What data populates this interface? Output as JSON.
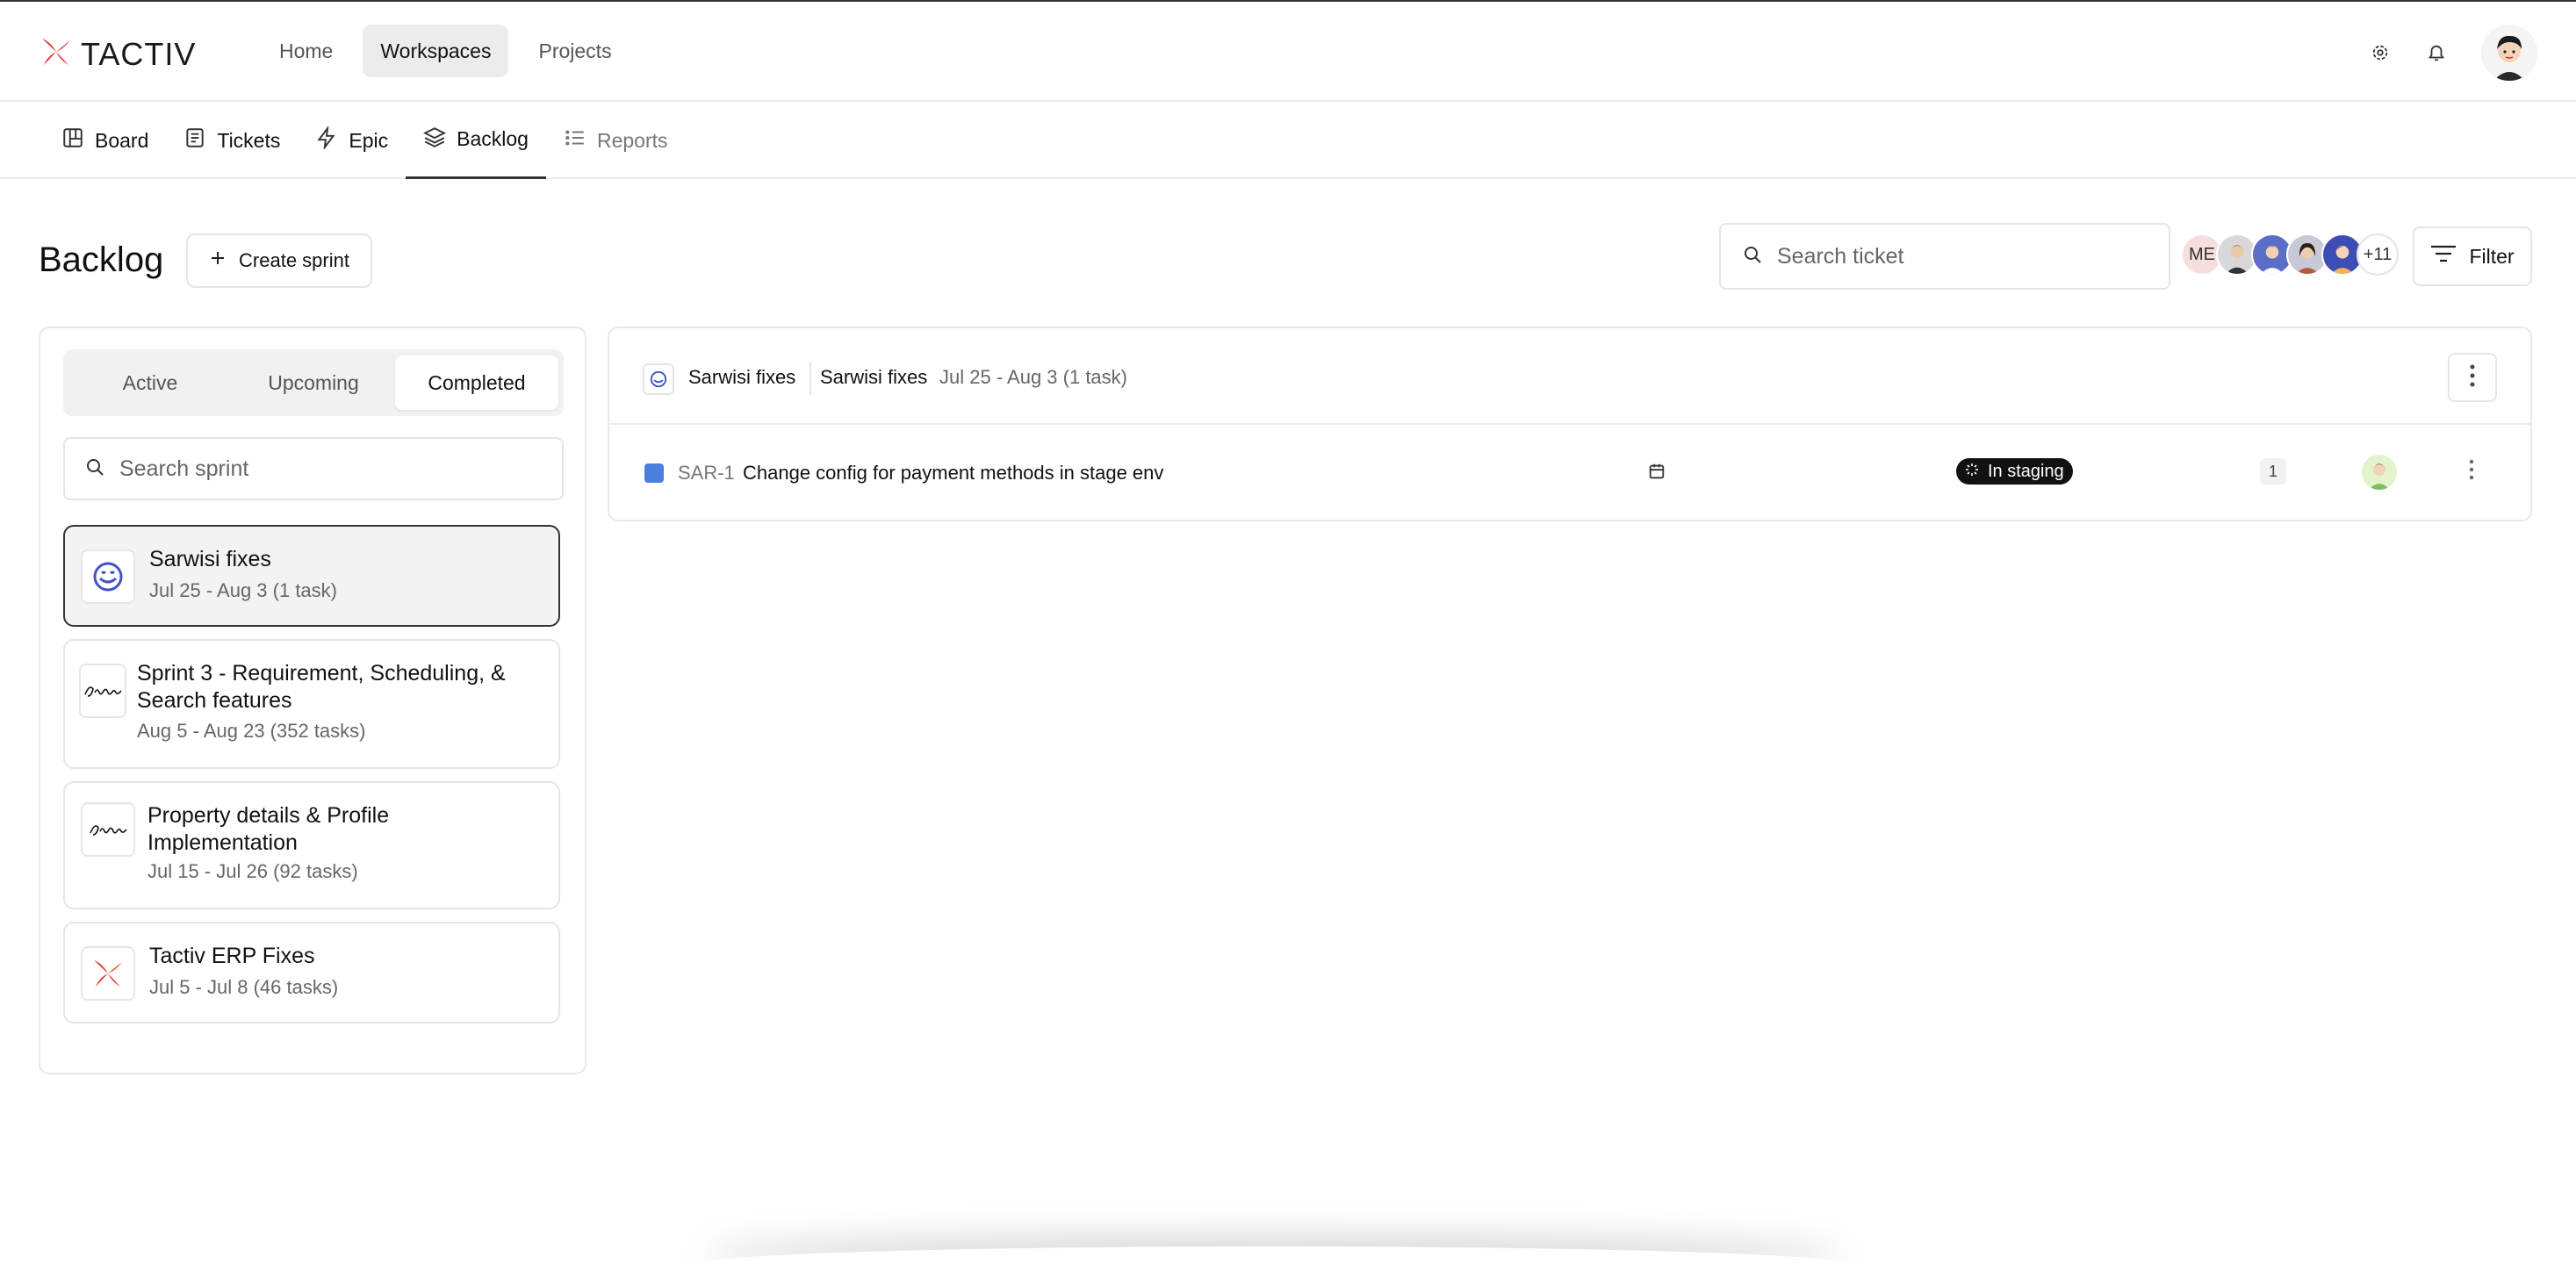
{
  "app": {
    "logo_text": "TACTIV",
    "brand_color": "#e0362c"
  },
  "topnav": [
    {
      "label": "Home",
      "active": false
    },
    {
      "label": "Workspaces",
      "active": true
    },
    {
      "label": "Projects",
      "active": false
    }
  ],
  "top_icons": [
    "gear-icon",
    "bell-icon",
    "user-avatar"
  ],
  "subnav": [
    {
      "label": "Board",
      "icon": "board-icon"
    },
    {
      "label": "Tickets",
      "icon": "tickets-icon"
    },
    {
      "label": "Epic",
      "icon": "lightning-icon"
    },
    {
      "label": "Backlog",
      "icon": "layers-icon",
      "active": true
    },
    {
      "label": "Reports",
      "icon": "list-icon",
      "muted": true
    }
  ],
  "page": {
    "title": "Backlog",
    "create_sprint_label": "Create sprint",
    "search_ticket_placeholder": "Search ticket",
    "members": {
      "me_initials": "ME",
      "more_count": "+11"
    },
    "filter_label": "Filter"
  },
  "sprint_panel": {
    "segments": [
      {
        "label": "Active",
        "active": false
      },
      {
        "label": "Upcoming",
        "active": false
      },
      {
        "label": "Completed",
        "active": true
      }
    ],
    "search_placeholder": "Search sprint",
    "sprints": [
      {
        "name": "Sarwisi fixes",
        "meta": "Jul 25 - Aug 3 (1 task)",
        "icon": "smile-logo-icon",
        "selected": true
      },
      {
        "name": "Sprint 3 - Requirement, Scheduling, & Search features",
        "meta": "Aug 5 - Aug 23 (352 tasks)",
        "icon": "signature-logo-icon",
        "selected": false
      },
      {
        "name": "Property details & Profile Implementation",
        "meta": "Jul 15 - Jul 26 (92 tasks)",
        "icon": "signature-logo-icon",
        "selected": false
      },
      {
        "name": "Tactiv ERP Fixes",
        "meta": "Jul 5 - Jul 8 (46 tasks)",
        "icon": "tactiv-logo-icon",
        "selected": false
      }
    ]
  },
  "sprint_detail": {
    "project_name": "Sarwisi fixes",
    "sprint_name": "Sarwisi fixes",
    "sprint_meta": "Jul 25 - Aug 3 (1 task)",
    "tickets": [
      {
        "key": "SAR-1",
        "title": "Change config for payment methods in stage env",
        "status": "In staging",
        "count": "1",
        "color": "#4a7fe0"
      }
    ]
  }
}
